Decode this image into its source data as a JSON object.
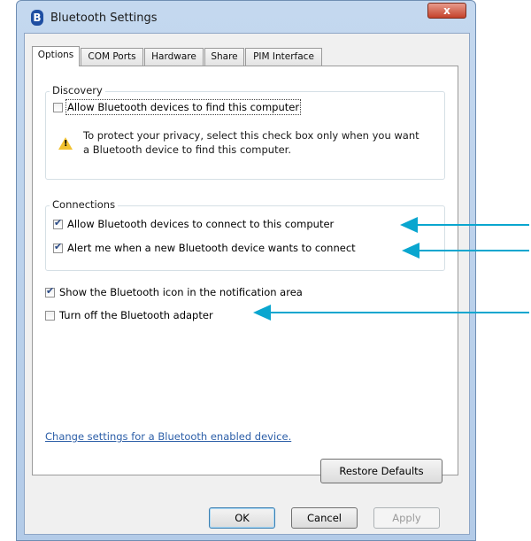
{
  "window": {
    "title": "Bluetooth Settings",
    "close_glyph": "x"
  },
  "tabs": [
    "Options",
    "COM Ports",
    "Hardware",
    "Share",
    "PIM Interface"
  ],
  "discovery": {
    "title": "Discovery",
    "allow_find": {
      "label": "Allow Bluetooth devices to find this computer",
      "checked": false
    },
    "note": "To protect your privacy, select this check box only when you want a Bluetooth device to find this computer."
  },
  "connections": {
    "title": "Connections",
    "allow_connect": {
      "label": "Allow Bluetooth devices to connect to this computer",
      "checked": true
    },
    "alert_new": {
      "label": "Alert me when a new Bluetooth device wants to connect",
      "checked": true
    }
  },
  "options": {
    "show_icon": {
      "label": "Show the Bluetooth icon in the notification area",
      "checked": true
    },
    "turn_off": {
      "label": "Turn off the Bluetooth adapter",
      "checked": false
    }
  },
  "link_text": "Change settings for a Bluetooth enabled device.",
  "buttons": {
    "restore": "Restore Defaults",
    "ok": "OK",
    "cancel": "Cancel",
    "apply": "Apply"
  },
  "colors": {
    "annotation_arrow": "#0aa6cf",
    "link": "#2d5fa8",
    "warning": "#f2c230"
  },
  "icons": [
    "bluetooth-icon",
    "close-icon",
    "warning-icon",
    "checkbox-icon",
    "arrow-icon"
  ]
}
